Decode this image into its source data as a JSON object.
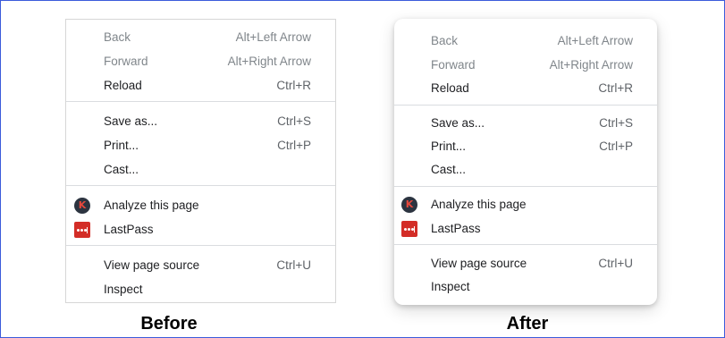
{
  "before": {
    "items": [
      {
        "label": "Back",
        "shortcut": "Alt+Left Arrow"
      },
      {
        "label": "Forward",
        "shortcut": "Alt+Right Arrow"
      },
      {
        "label": "Reload",
        "shortcut": "Ctrl+R"
      },
      {
        "label": "Save as...",
        "shortcut": "Ctrl+S"
      },
      {
        "label": "Print...",
        "shortcut": "Ctrl+P"
      },
      {
        "label": "Cast..."
      },
      {
        "label": "Analyze this page",
        "icon": "k-circle-icon",
        "icon_glyph": "K"
      },
      {
        "label": "LastPass",
        "icon": "lastpass-icon"
      },
      {
        "label": "View page source",
        "shortcut": "Ctrl+U"
      },
      {
        "label": "Inspect"
      }
    ]
  },
  "after": {
    "items": [
      {
        "label": "Back",
        "shortcut": "Alt+Left Arrow"
      },
      {
        "label": "Forward",
        "shortcut": "Alt+Right Arrow"
      },
      {
        "label": "Reload",
        "shortcut": "Ctrl+R"
      },
      {
        "label": "Save as...",
        "shortcut": "Ctrl+S"
      },
      {
        "label": "Print...",
        "shortcut": "Ctrl+P"
      },
      {
        "label": "Cast..."
      },
      {
        "label": "Analyze this page",
        "icon": "k-circle-icon",
        "icon_glyph": "K"
      },
      {
        "label": "LastPass",
        "icon": "lastpass-icon"
      },
      {
        "label": "View page source",
        "shortcut": "Ctrl+U"
      },
      {
        "label": "Inspect"
      }
    ]
  },
  "captions": {
    "before": "Before",
    "after": "After"
  },
  "colors": {
    "frame_border": "#3b5bdb",
    "disabled_text": "#80868b",
    "lastpass_red": "#d32d27",
    "extension_k_bg": "#2c3440"
  }
}
